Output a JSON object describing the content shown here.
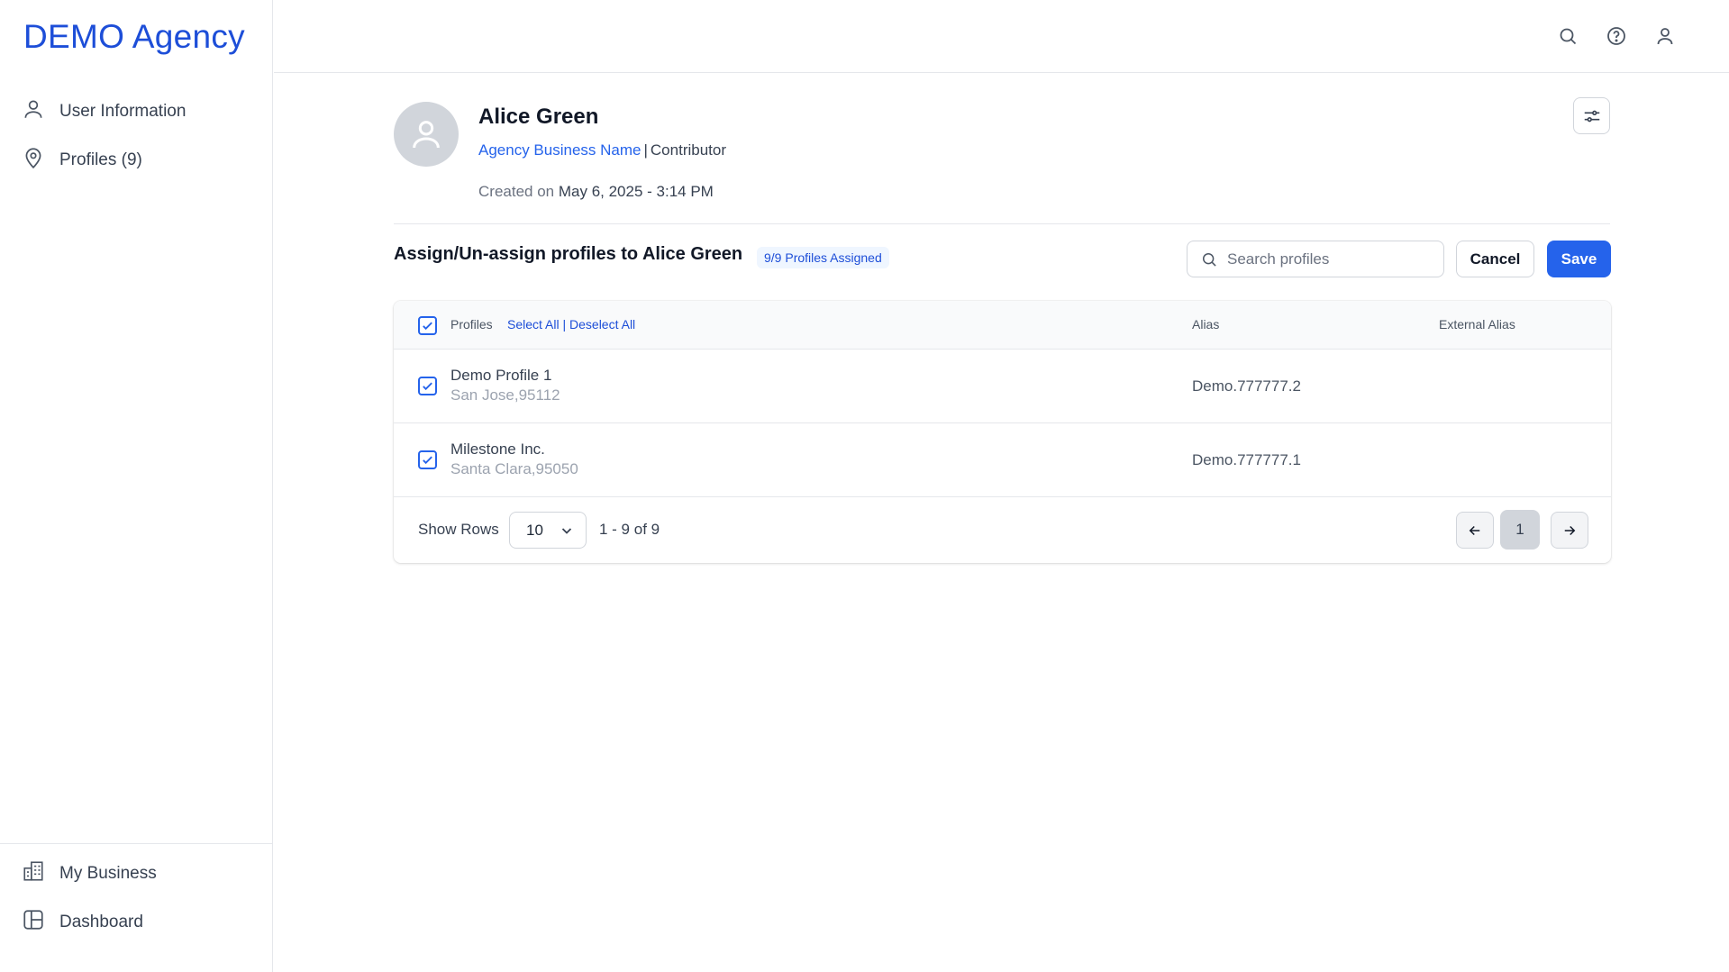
{
  "brand": "DEMO Agency",
  "sidebar": {
    "top_items": [
      {
        "label": "User Information",
        "icon": "user-icon"
      },
      {
        "label": "Profiles (9)",
        "icon": "location-pin-icon"
      }
    ],
    "bottom_items": [
      {
        "label": "My Business",
        "icon": "building-icon"
      },
      {
        "label": "Dashboard",
        "icon": "dashboard-icon"
      }
    ]
  },
  "topbar": {
    "icons": [
      "search-icon",
      "help-icon",
      "account-icon"
    ]
  },
  "user": {
    "name": "Alice Green",
    "business": "Agency Business Name",
    "separator": "|",
    "role": "Contributor",
    "created_label": "Created on",
    "created_date": "May 6, 2025 - 3:14 PM"
  },
  "section": {
    "title": "Assign/Un-assign profiles to Alice Green",
    "badge": "9/9 Profiles Assigned",
    "search_placeholder": "Search profiles",
    "cancel_label": "Cancel",
    "save_label": "Save"
  },
  "table": {
    "headers": {
      "profiles": "Profiles",
      "select_all": "Select All",
      "link_sep": "|",
      "deselect_all": "Deselect All",
      "alias": "Alias",
      "external_alias": "External Alias"
    },
    "rows": [
      {
        "name": "Demo Profile 1",
        "location": "San Jose,95112",
        "alias": "Demo.777777.2",
        "external_alias": "",
        "checked": true
      },
      {
        "name": "Milestone Inc.",
        "location": "Santa Clara,95050",
        "alias": "Demo.777777.1",
        "external_alias": "",
        "checked": true
      }
    ],
    "header_checked": true
  },
  "pagination": {
    "show_rows_label": "Show Rows",
    "rows_value": "10",
    "range": "1 - 9 of 9",
    "current_page": "1"
  },
  "colors": {
    "accent": "#2563eb",
    "brand": "#1d4ed8"
  }
}
